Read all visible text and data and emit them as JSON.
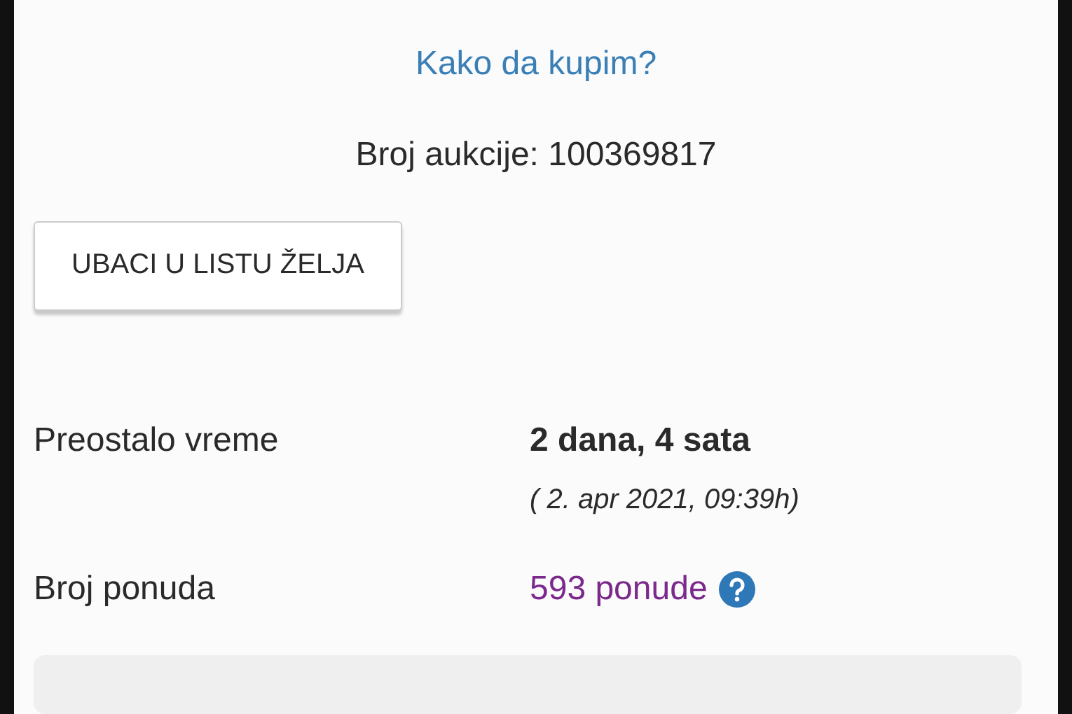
{
  "how_to_buy_link": "Kako da kupim?",
  "auction_number": "Broj aukcije: 100369817",
  "wishlist_button": "UBACI U LISTU ŽELJA",
  "details": [
    {
      "kind": "time",
      "label": "Preostalo vreme",
      "value": "2 dana, 4 sata",
      "note": "( 2. apr 2021, 09:39h)"
    },
    {
      "kind": "bids",
      "label": "Broj ponuda",
      "value": "593 ponude",
      "help": true
    }
  ]
}
